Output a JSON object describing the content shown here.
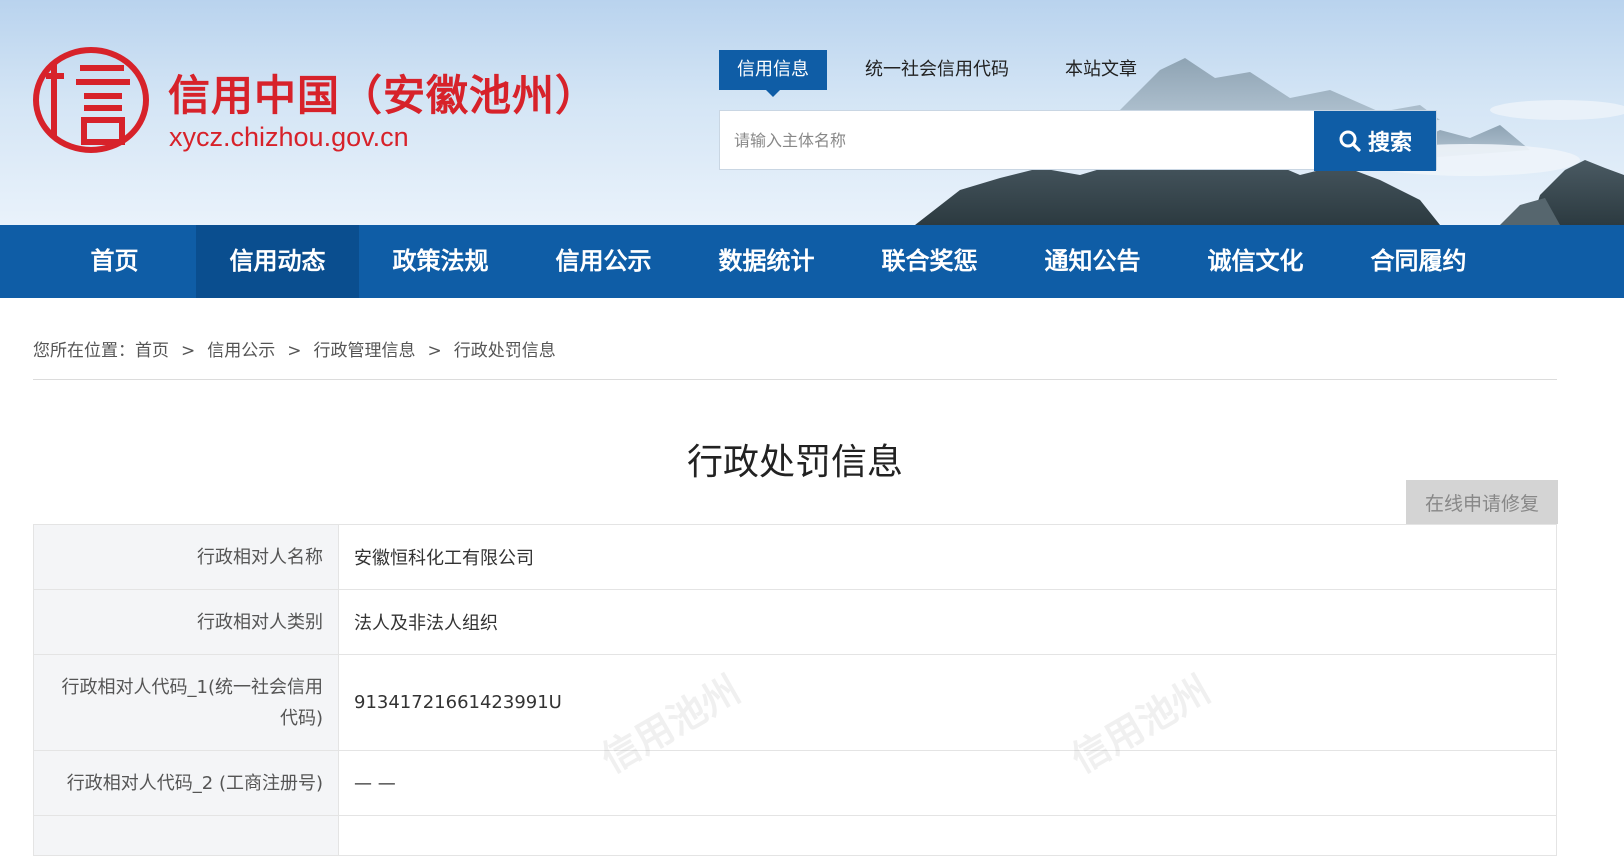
{
  "site": {
    "title": "信用中国（安徽池州）",
    "url": "xycz.chizhou.gov.cn",
    "logo_icon": "xin-seal-icon",
    "brand_color": "#d7222a",
    "accent_color": "#0f5da6"
  },
  "search": {
    "tabs": [
      {
        "label": "信用信息",
        "active": true
      },
      {
        "label": "统一社会信用代码",
        "active": false
      },
      {
        "label": "本站文章",
        "active": false
      }
    ],
    "placeholder": "请输入主体名称",
    "button_label": "搜索",
    "button_icon": "search-icon"
  },
  "nav": {
    "items": [
      {
        "label": "首页",
        "active": false
      },
      {
        "label": "信用动态",
        "active": true
      },
      {
        "label": "政策法规",
        "active": false
      },
      {
        "label": "信用公示",
        "active": false
      },
      {
        "label": "数据统计",
        "active": false
      },
      {
        "label": "联合奖惩",
        "active": false
      },
      {
        "label": "通知公告",
        "active": false
      },
      {
        "label": "诚信文化",
        "active": false
      },
      {
        "label": "合同履约",
        "active": false
      }
    ]
  },
  "breadcrumb": {
    "prefix": "您所在位置：",
    "items": [
      "首页",
      "信用公示",
      "行政管理信息",
      "行政处罚信息"
    ],
    "separator": ">"
  },
  "page": {
    "title": "行政处罚信息",
    "repair_button": "在线申请修复",
    "watermark": "信用池州"
  },
  "table": {
    "rows": [
      {
        "label": "行政相对人名称",
        "value": "安徽恒科化工有限公司"
      },
      {
        "label": "行政相对人类别",
        "value": "法人及非法人组织"
      },
      {
        "label": "行政相对人代码_1(统一社会信用代码)",
        "value": "91341721661423991U"
      },
      {
        "label": "行政相对人代码_2 (工商注册号)",
        "value": "— —"
      },
      {
        "label": "",
        "value": ""
      }
    ]
  }
}
